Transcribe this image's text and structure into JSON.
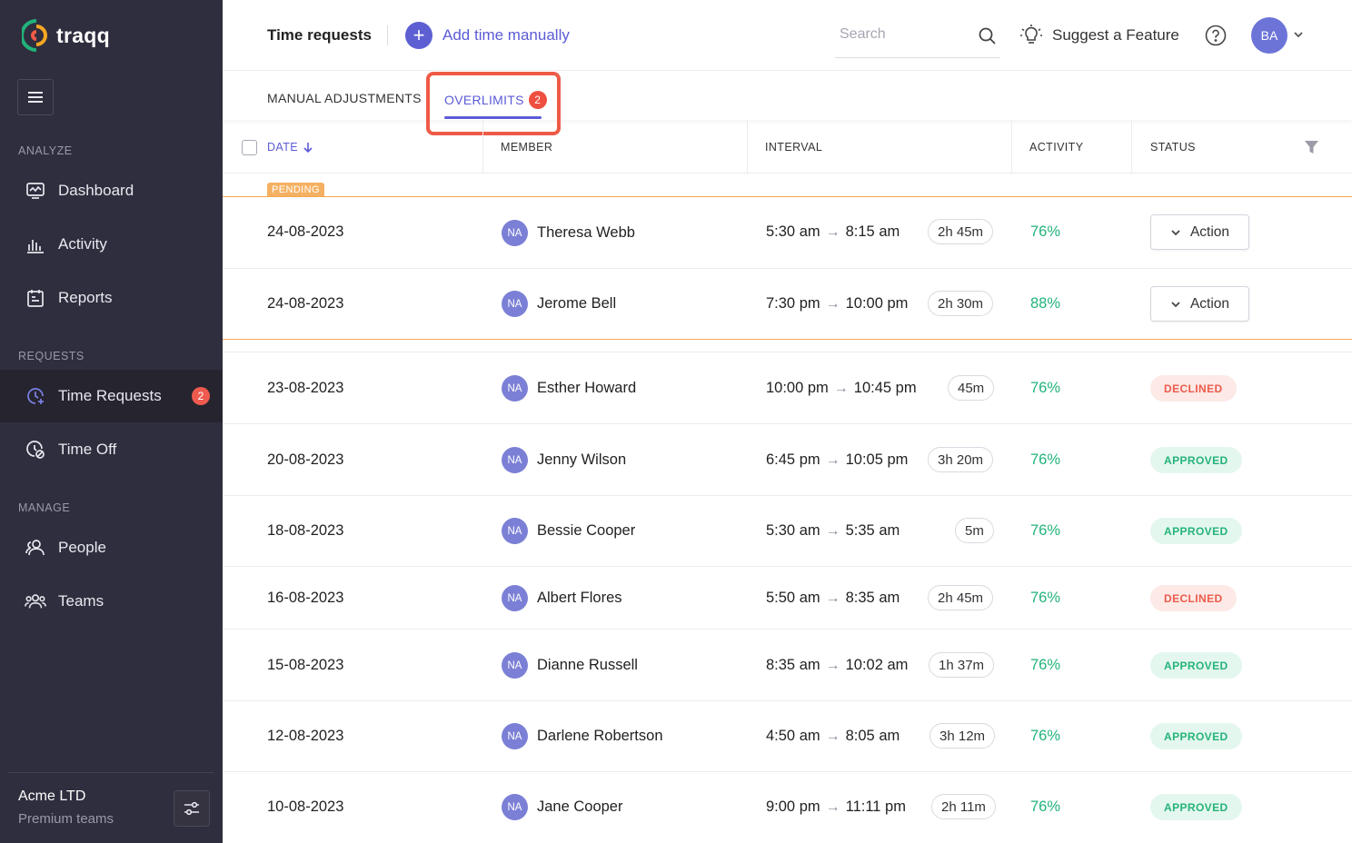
{
  "sidebar": {
    "brand": "traqq",
    "sections": {
      "analyze": "ANALYZE",
      "requests": "REQUESTS",
      "manage": "MANAGE"
    },
    "items": [
      {
        "label": "Dashboard",
        "icon": "dashboard-icon"
      },
      {
        "label": "Activity",
        "icon": "activity-icon"
      },
      {
        "label": "Reports",
        "icon": "reports-icon"
      },
      {
        "label": "Time Requests",
        "icon": "time-requests-icon",
        "badge": "2",
        "active": true
      },
      {
        "label": "Time Off",
        "icon": "time-off-icon"
      },
      {
        "label": "People",
        "icon": "people-icon"
      },
      {
        "label": "Teams",
        "icon": "teams-icon"
      }
    ],
    "org": {
      "name": "Acme LTD",
      "plan": "Premium teams"
    }
  },
  "header": {
    "title": "Time requests",
    "add_manual": "Add time manually",
    "search_placeholder": "Search",
    "suggest": "Suggest a Feature",
    "avatar": "BA"
  },
  "tabs": [
    {
      "label": "MANUAL ADJUSTMENTS"
    },
    {
      "label": "OVERLIMITS",
      "badge": "2",
      "active": true
    }
  ],
  "table": {
    "columns": {
      "date": "DATE",
      "member": "MEMBER",
      "interval": "INTERVAL",
      "activity": "ACTIVITY",
      "status": "STATUS"
    },
    "pending_label": "PENDING",
    "action_label": "Action",
    "rows": [
      {
        "date": "24-08-2023",
        "initials": "NA",
        "member": "Theresa Webb",
        "start": "5:30 am",
        "end": "8:15 am",
        "duration": "2h 45m",
        "activity": "76%",
        "status": "pending"
      },
      {
        "date": "24-08-2023",
        "initials": "NA",
        "member": "Jerome Bell",
        "start": "7:30 pm",
        "end": "10:00 pm",
        "duration": "2h 30m",
        "activity": "88%",
        "status": "pending"
      },
      {
        "date": "23-08-2023",
        "initials": "NA",
        "member": "Esther Howard",
        "start": "10:00 pm",
        "end": "10:45 pm",
        "duration": "45m",
        "activity": "76%",
        "status": "DECLINED"
      },
      {
        "date": "20-08-2023",
        "initials": "NA",
        "member": "Jenny Wilson",
        "start": "6:45 pm",
        "end": "10:05 pm",
        "duration": "3h 20m",
        "activity": "76%",
        "status": "APPROVED"
      },
      {
        "date": "18-08-2023",
        "initials": "NA",
        "member": "Bessie Cooper",
        "start": "5:30 am",
        "end": "5:35 am",
        "duration": "5m",
        "activity": "76%",
        "status": "APPROVED"
      },
      {
        "date": "16-08-2023",
        "initials": "NA",
        "member": "Albert Flores",
        "start": "5:50 am",
        "end": "8:35 am",
        "duration": "2h 45m",
        "activity": "76%",
        "status": "DECLINED"
      },
      {
        "date": "15-08-2023",
        "initials": "NA",
        "member": "Dianne Russell",
        "start": "8:35 am",
        "end": "10:02 am",
        "duration": "1h 37m",
        "activity": "76%",
        "status": "APPROVED"
      },
      {
        "date": "12-08-2023",
        "initials": "NA",
        "member": "Darlene Robertson",
        "start": "4:50 am",
        "end": "8:05 am",
        "duration": "3h 12m",
        "activity": "76%",
        "status": "APPROVED"
      },
      {
        "date": "10-08-2023",
        "initials": "NA",
        "member": "Jane Cooper",
        "start": "9:00 pm",
        "end": "11:11 pm",
        "duration": "2h 11m",
        "activity": "76%",
        "status": "APPROVED"
      }
    ]
  },
  "colors": {
    "accent": "#5b5bd6",
    "sidebar_bg": "#2f2e3e",
    "pending": "#f2a850",
    "approved": "#25b37b",
    "declined": "#ec5b4c"
  }
}
